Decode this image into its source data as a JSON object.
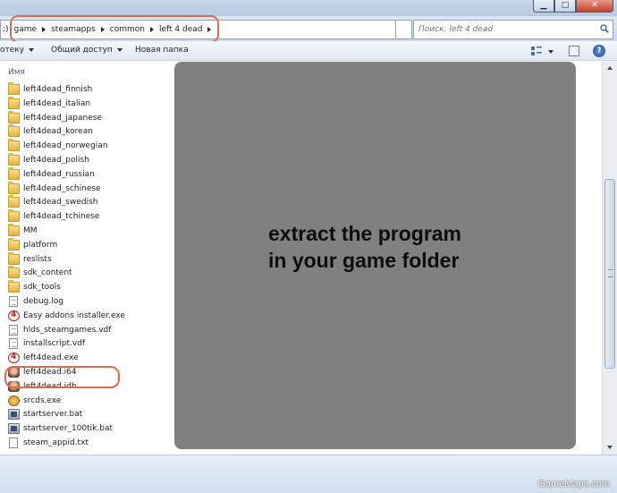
{
  "breadcrumb": {
    "prefix": ":)",
    "crumbs": [
      "game",
      "steamapps",
      "common",
      "left 4 dead"
    ]
  },
  "search": {
    "placeholder": "Поиск: left 4 dead"
  },
  "toolbar": {
    "organize": "отеку",
    "share": "Общий доступ",
    "new_folder": "Новая папка"
  },
  "columns": {
    "name": "Имя"
  },
  "files": [
    {
      "name": "left4dead_finnish",
      "icon": "folder-icon"
    },
    {
      "name": "left4dead_italian",
      "icon": "folder-icon"
    },
    {
      "name": "left4dead_japanese",
      "icon": "folder-icon"
    },
    {
      "name": "left4dead_korean",
      "icon": "folder-icon"
    },
    {
      "name": "left4dead_norwegian",
      "icon": "folder-icon"
    },
    {
      "name": "left4dead_polish",
      "icon": "folder-icon"
    },
    {
      "name": "left4dead_russian",
      "icon": "folder-icon"
    },
    {
      "name": "left4dead_schinese",
      "icon": "folder-icon"
    },
    {
      "name": "left4dead_swedish",
      "icon": "folder-icon"
    },
    {
      "name": "left4dead_tchinese",
      "icon": "folder-icon"
    },
    {
      "name": "MM",
      "icon": "folder-icon"
    },
    {
      "name": "platform",
      "icon": "folder-icon"
    },
    {
      "name": "reslists",
      "icon": "folder-icon"
    },
    {
      "name": "sdk_content",
      "icon": "folder-icon"
    },
    {
      "name": "sdk_tools",
      "icon": "folder-icon"
    },
    {
      "name": "debug.log",
      "icon": "file-icon"
    },
    {
      "name": "Easy addons installer.exe",
      "icon": "l4d-icon"
    },
    {
      "name": "hlds_steamgames.vdf",
      "icon": "file-icon"
    },
    {
      "name": "installscript.vdf",
      "icon": "file-icon"
    },
    {
      "name": "left4dead.exe",
      "icon": "l4d-icon"
    },
    {
      "name": "left4dead.i64",
      "icon": "face-icon"
    },
    {
      "name": "left4dead.idb",
      "icon": "face-icon"
    },
    {
      "name": "srcds.exe",
      "icon": "srcds-icon"
    },
    {
      "name": "startserver.bat",
      "icon": "bat-icon"
    },
    {
      "name": "startserver_100tik.bat",
      "icon": "bat-icon"
    },
    {
      "name": "steam_appid.txt",
      "icon": "text-file-icon"
    }
  ],
  "overlay": {
    "line1": "extract the program",
    "line2": "in your game folder"
  },
  "watermark": "GameMaps.com",
  "colors": {
    "highlight_circle": "#e2684a",
    "overlay_panel": "#808080"
  }
}
